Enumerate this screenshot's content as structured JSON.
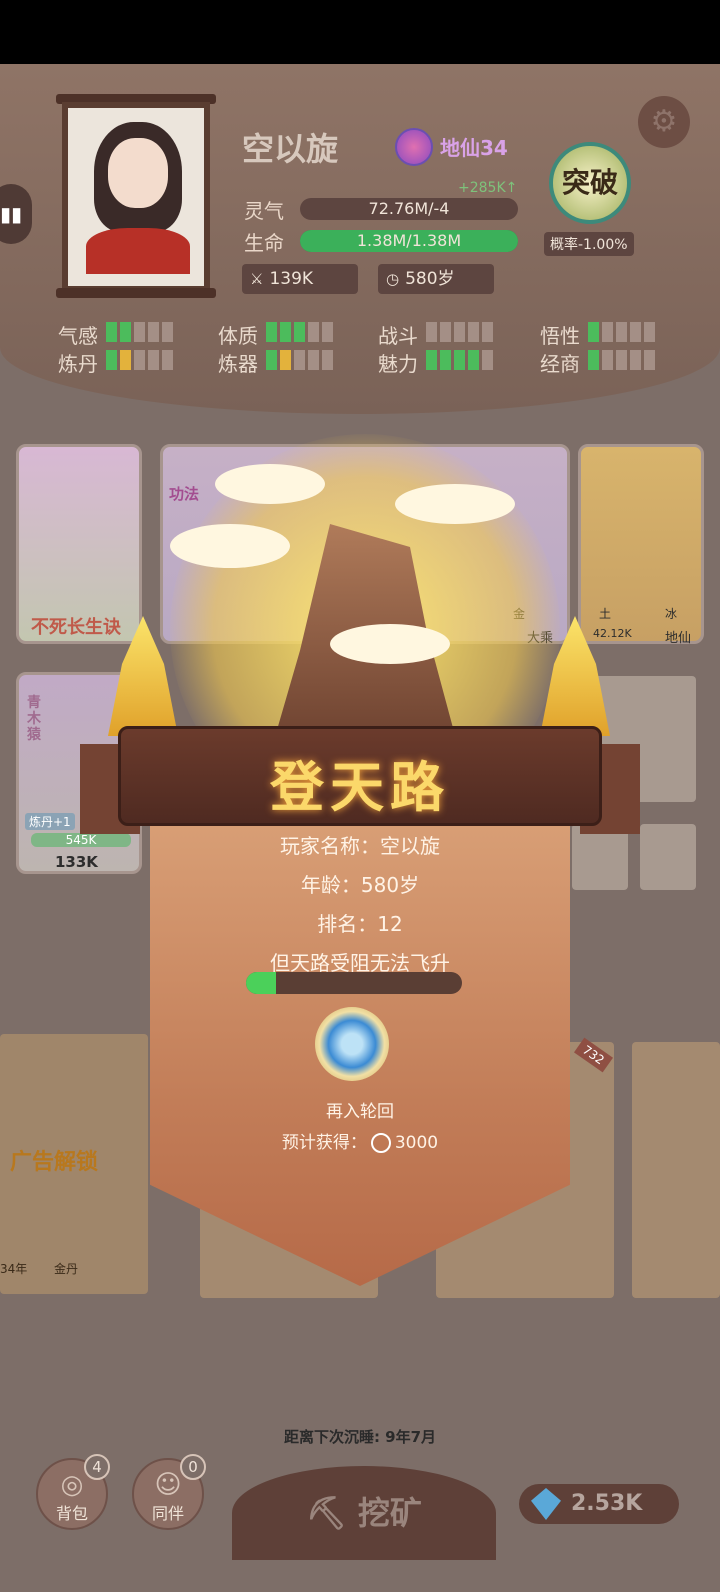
{
  "player": {
    "name": "空以旋",
    "realm": "地仙34",
    "lingqi_label": "灵气",
    "lingqi_value": "72.76M/-4",
    "lingqi_gain": "+285K↑",
    "life_label": "生命",
    "life_value": "1.38M/1.38M",
    "life_fraction": 1.0,
    "power": "139K",
    "age": "580岁",
    "breakthrough_label": "突破",
    "breakthrough_rate": "概率-1.00%"
  },
  "attributes": [
    {
      "label": "气感",
      "level": 2
    },
    {
      "label": "体质",
      "level": 3
    },
    {
      "label": "战斗",
      "level": 0
    },
    {
      "label": "悟性",
      "level": 1
    },
    {
      "label": "炼丹",
      "level": 2
    },
    {
      "label": "炼器",
      "level": 2
    },
    {
      "label": "魅力",
      "level": 4
    },
    {
      "label": "经商",
      "level": 1
    }
  ],
  "cards": {
    "book_title": "不死长生诀",
    "technique_label": "功法",
    "tags": [
      "金",
      "大乘",
      "土",
      "冰",
      "42.12K",
      "地仙"
    ],
    "pet": {
      "name": "青木猿",
      "tag": "炼丹+1",
      "bar": "545K",
      "power": "133K"
    },
    "ad_unlock": "广告解锁",
    "ad_small": [
      "34年",
      "金丹"
    ],
    "counter": "732"
  },
  "popup": {
    "title": "登天路",
    "player_name_line": "玩家名称：空以旋",
    "age_line": "年龄：580岁",
    "rank_line": "排名：12",
    "status_line": "但天路受阻无法飞升",
    "progress_fraction": 0.14,
    "button_label": "再入轮回",
    "reward_label": "预计获得：",
    "reward_value": "3000"
  },
  "bottom": {
    "sleep_text": "距离下次沉睡: 9年7月",
    "bag_label": "背包",
    "bag_count": "4",
    "partner_label": "同伴",
    "partner_count": "0",
    "mine_label": "挖矿",
    "gems": "2.53K"
  },
  "colors": {
    "accent_green": "#3bb05a",
    "title_gold": "#fbd86a",
    "panel_brown": "#5e4038"
  },
  "icons": [
    "settings-gear-icon",
    "chat-icon",
    "sword-icon",
    "clock-icon",
    "swirl-icon",
    "bag-icon",
    "partner-icon",
    "pickaxe-icon",
    "gem-icon"
  ]
}
